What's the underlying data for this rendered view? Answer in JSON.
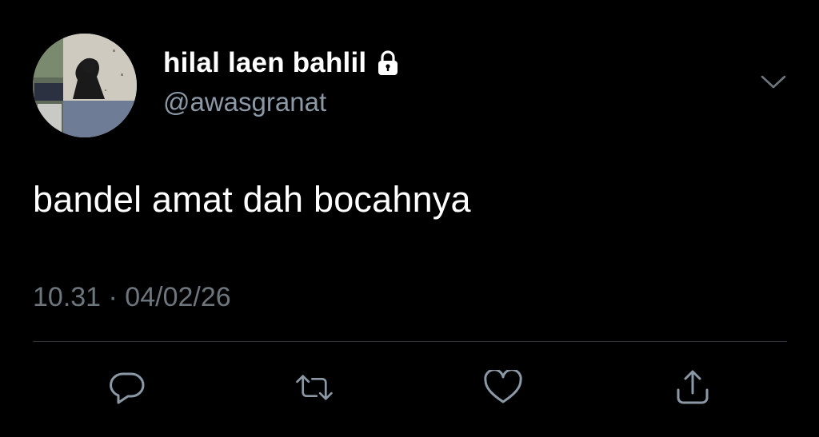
{
  "tweet": {
    "display_name": "hilal laen bahlil",
    "handle": "@awasgranat",
    "text": "bandel amat dah bocahnya",
    "timestamp": "10.31 · 04/02/26",
    "account_locked_icon": "lock-icon",
    "menu_icon": "chevron-down-icon"
  },
  "actions": [
    {
      "name": "reply",
      "icon": "comment-icon"
    },
    {
      "name": "retweet",
      "icon": "retweet-icon"
    },
    {
      "name": "like",
      "icon": "heart-icon"
    },
    {
      "name": "share",
      "icon": "share-icon"
    }
  ],
  "colors": {
    "background": "#000000",
    "text_primary": "#ffffff",
    "text_secondary": "#8b98a5",
    "timestamp": "#6e767d",
    "icon": "#8b98a5",
    "divider": "#2f3336"
  }
}
